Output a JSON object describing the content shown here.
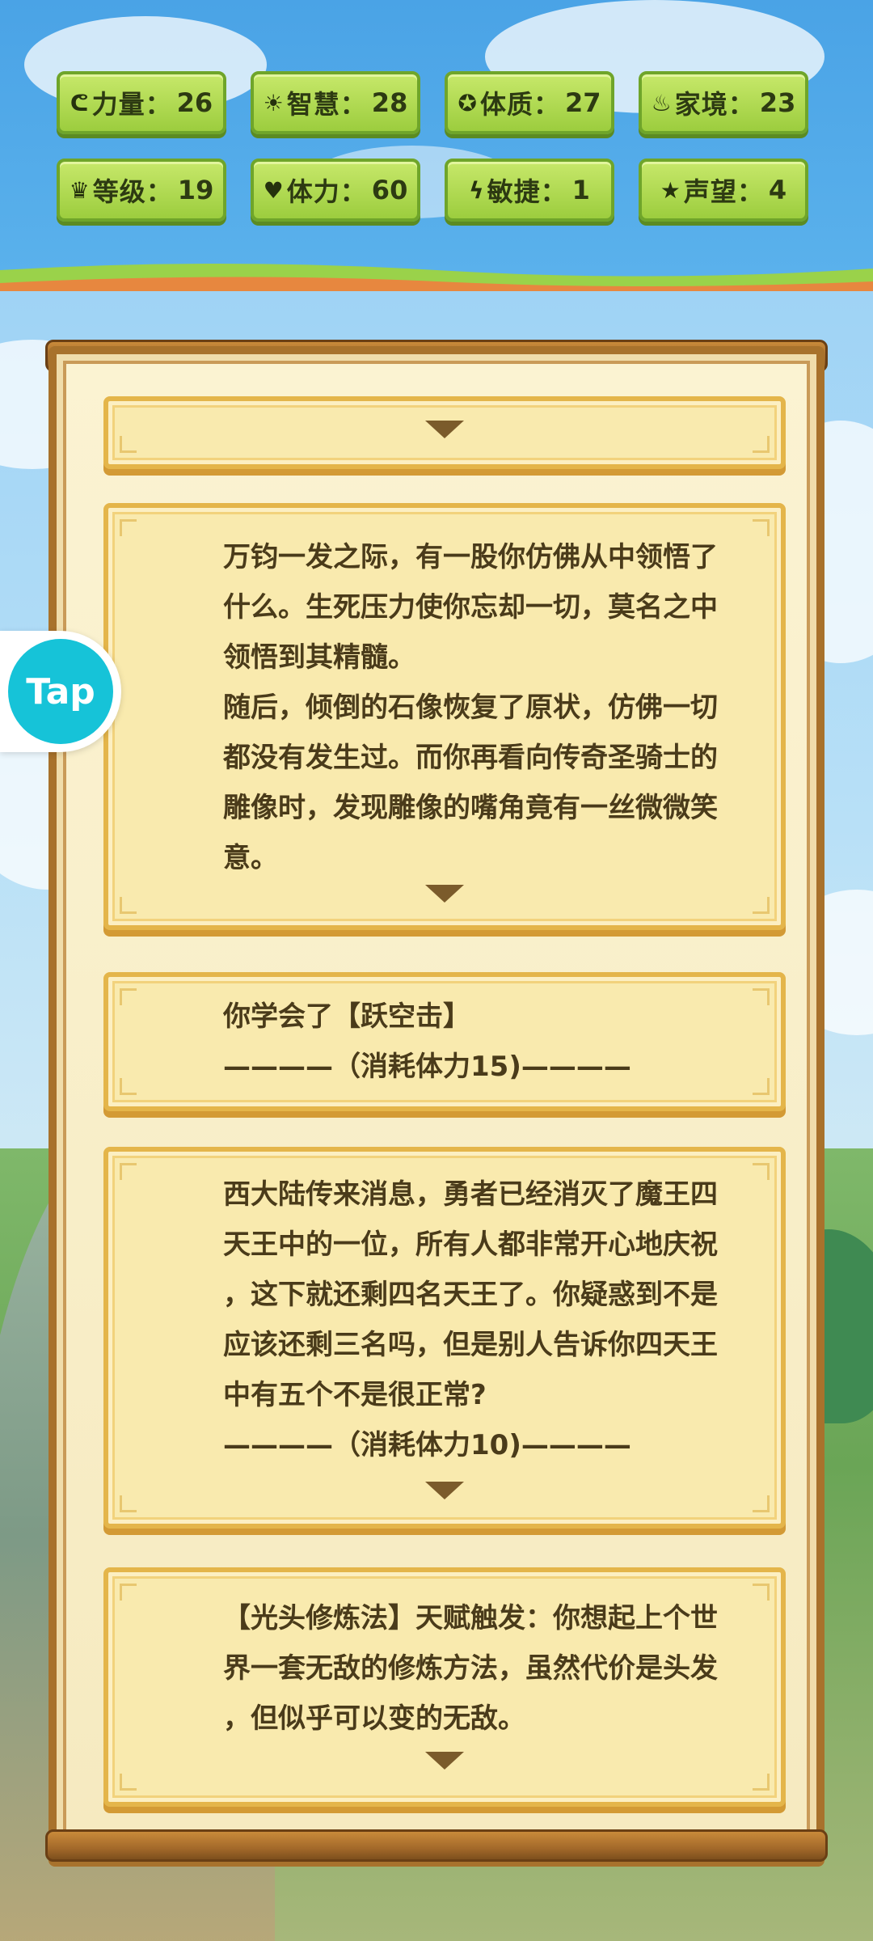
{
  "stats": [
    {
      "icon": "strength-icon",
      "glyph": "ᕦ",
      "label": "力量：",
      "value": "26"
    },
    {
      "icon": "wisdom-icon",
      "glyph": "☀",
      "label": "智慧：",
      "value": "28"
    },
    {
      "icon": "constitution-icon",
      "glyph": "✪",
      "label": "体质：",
      "value": "27"
    },
    {
      "icon": "family-icon",
      "glyph": "♨",
      "label": "家境：",
      "value": "23"
    },
    {
      "icon": "crown-icon",
      "glyph": "♛",
      "label": "等级：",
      "value": "19"
    },
    {
      "icon": "heart-icon",
      "glyph": "♥",
      "label": "体力：",
      "value": "60"
    },
    {
      "icon": "lightning-icon",
      "glyph": "ϟ",
      "label": "敏捷：",
      "value": "1"
    },
    {
      "icon": "star-icon",
      "glyph": "★",
      "label": "声望：",
      "value": "4"
    }
  ],
  "events": [
    {
      "lines": []
    },
    {
      "lines": [
        "万钧一发之际，有一股你仿佛从中领悟了",
        "什么。生死压力使你忘却一切，莫名之中",
        "领悟到其精髓。",
        "随后，倾倒的石像恢复了原状，仿佛一切",
        "都没有发生过。而你再看向传奇圣骑士的",
        "雕像时，发现雕像的嘴角竟有一丝微微笑",
        "意。"
      ]
    },
    {
      "lines": [
        "你学会了【跃空击】",
        "————（消耗体力15)————"
      ]
    },
    {
      "lines": [
        "西大陆传来消息，勇者已经消灭了魔王四",
        "天王中的一位，所有人都非常开心地庆祝",
        "，这下就还剩四名天王了。你疑惑到不是",
        "应该还剩三名吗，但是别人告诉你四天王",
        "中有五个不是很正常?",
        "————（消耗体力10)————"
      ]
    },
    {
      "lines": [
        "【光头修炼法】天赋触发：你想起上个世",
        "界一套无敌的修炼方法，虽然代价是头发",
        "，但似乎可以变的无敌。"
      ]
    }
  ],
  "tap_button": {
    "label": "Tap"
  }
}
